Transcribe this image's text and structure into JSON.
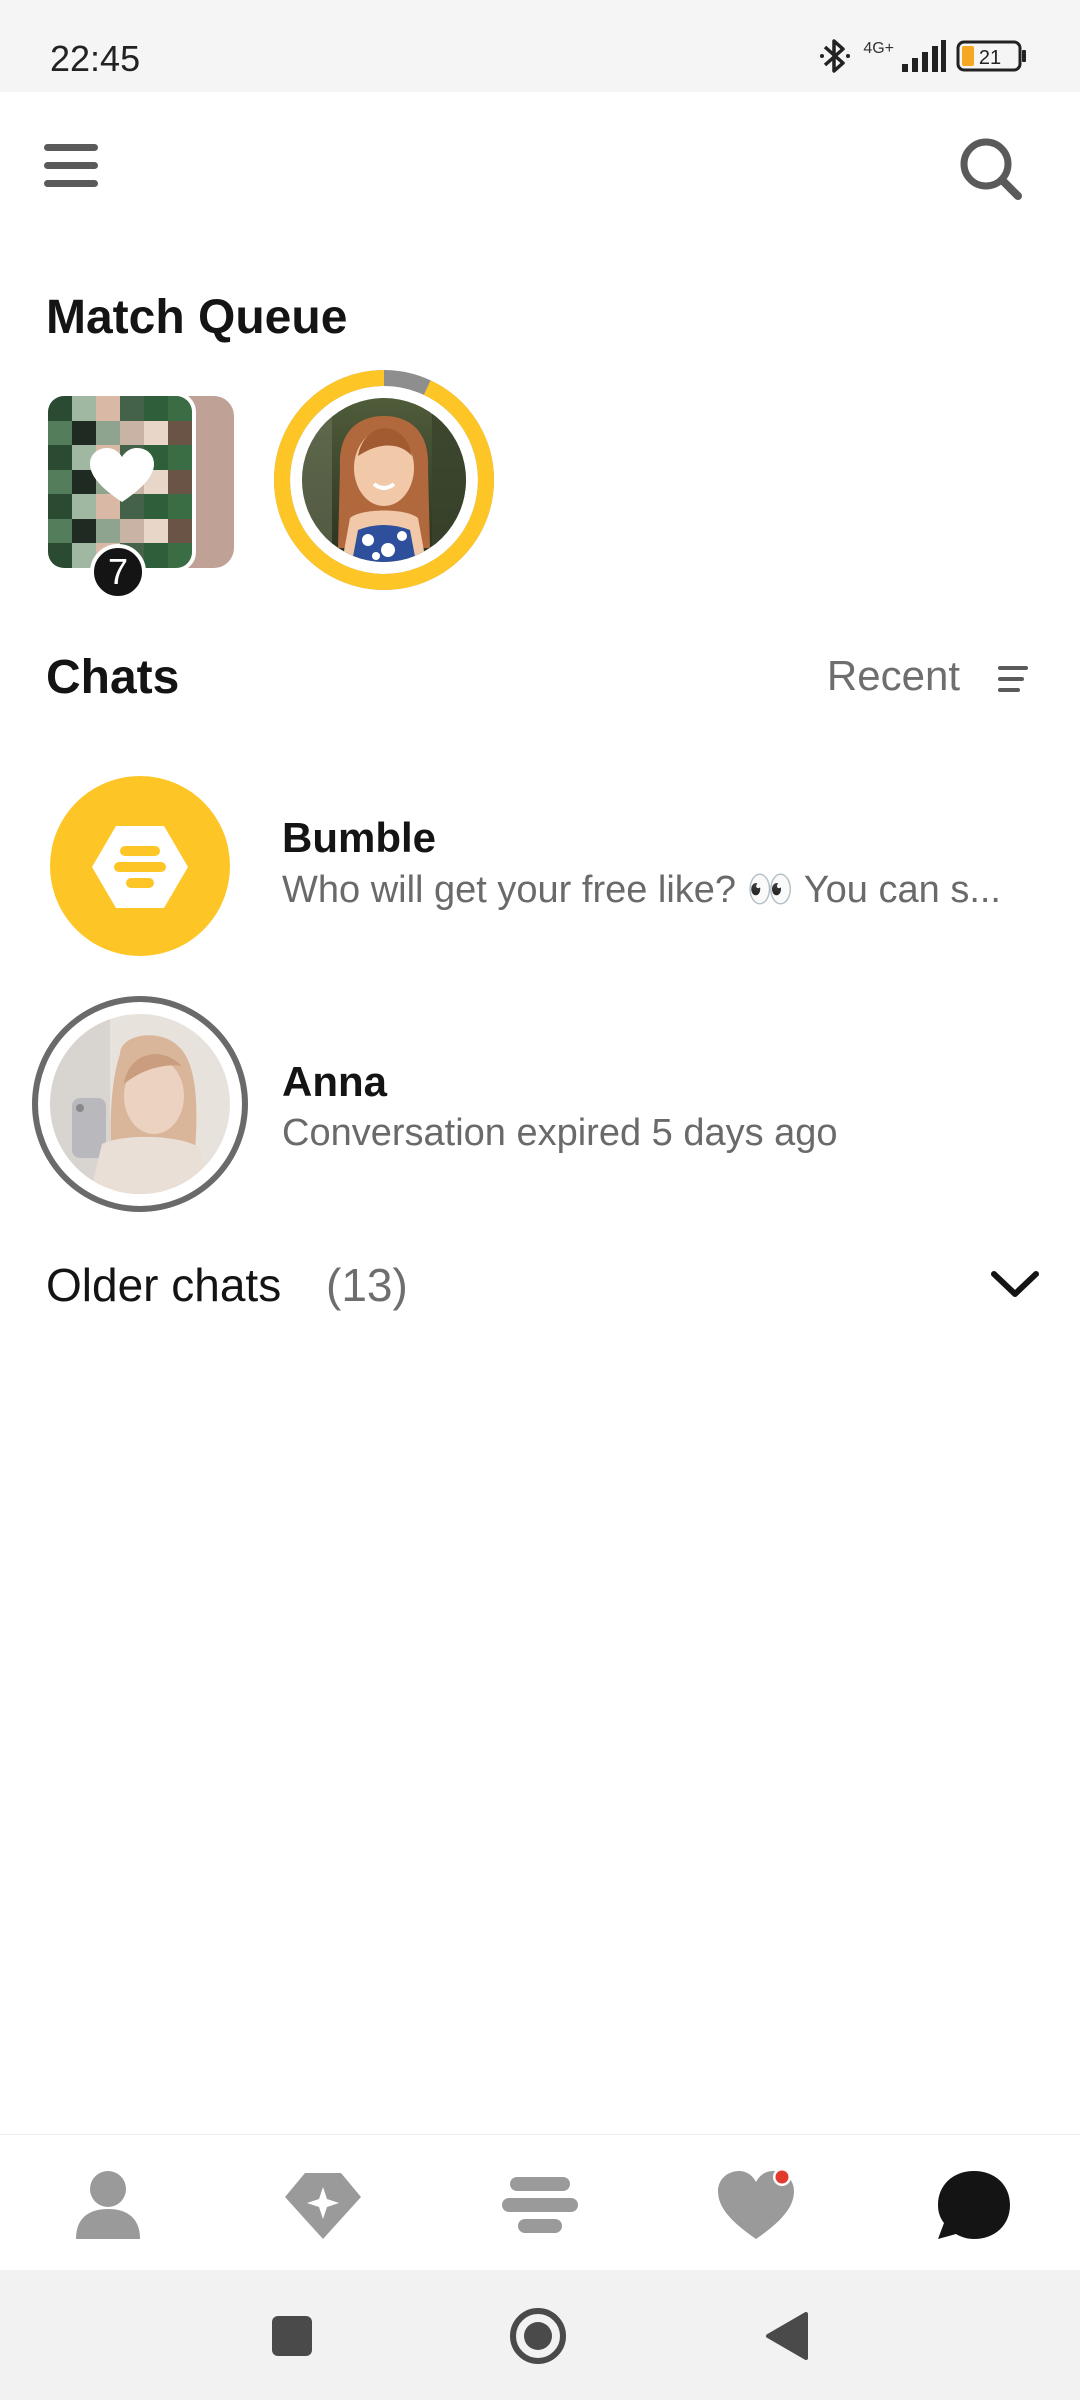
{
  "status_bar": {
    "time": "22:45",
    "network": "4G+",
    "battery": "21",
    "icons": [
      "bluetooth-icon",
      "signal-icon",
      "battery-icon"
    ]
  },
  "header": {
    "menu_icon": "hamburger-menu-icon",
    "search_icon": "search-icon"
  },
  "match_queue": {
    "title": "Match Queue",
    "hidden_likes_count": "7",
    "ring_progress": 0.93
  },
  "chats": {
    "title": "Chats",
    "sort_label": "Recent",
    "items": [
      {
        "name": "Bumble",
        "preview": "Who will get your free like? 👀 You can s...",
        "avatar": "bumble-logo"
      },
      {
        "name": "Anna",
        "preview": "Conversation expired 5 days ago",
        "avatar": "photo"
      }
    ],
    "older_label": "Older chats",
    "older_count": "(13)"
  },
  "bottom_nav": {
    "tabs": [
      "profile-icon",
      "premium-diamond-icon",
      "discover-bumble-icon",
      "likes-heart-icon",
      "chats-bubble-icon"
    ],
    "active": "chats-bubble-icon"
  },
  "colors": {
    "brand_yellow": "#fdc626",
    "text_dark": "#141414",
    "text_muted": "#6a6a6a",
    "icon_gray": "#9a9a9a",
    "notification_red": "#e23b2e"
  }
}
